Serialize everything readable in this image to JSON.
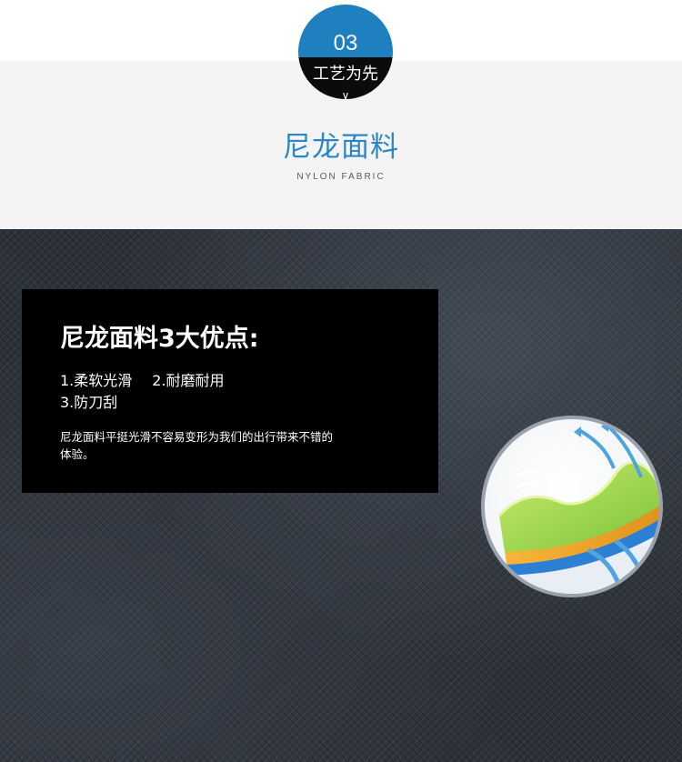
{
  "section_badge": {
    "number": "03",
    "label": "工艺为先",
    "chevron": "∨"
  },
  "header": {
    "title": "尼龙面料",
    "subtitle": "NYLON FABRIC"
  },
  "info_box": {
    "heading": "尼龙面料3大优点:",
    "advantage_1": "1.柔软光滑",
    "advantage_2": "2.耐磨耐用",
    "advantage_3": "3.防刀刮",
    "description": "尼龙面料平挺光滑不容易变形为我们的出行带来不错的体验。"
  },
  "illustration": {
    "icon": "fabric-layer-cross-section-icon"
  },
  "colors": {
    "badge_blue": "#1f80c0",
    "badge_black": "#0b0b0b",
    "title_blue": "#2a86c4",
    "header_band": "#f4f4f4",
    "fabric_dark": "#2b3139",
    "box_black": "#000000"
  }
}
